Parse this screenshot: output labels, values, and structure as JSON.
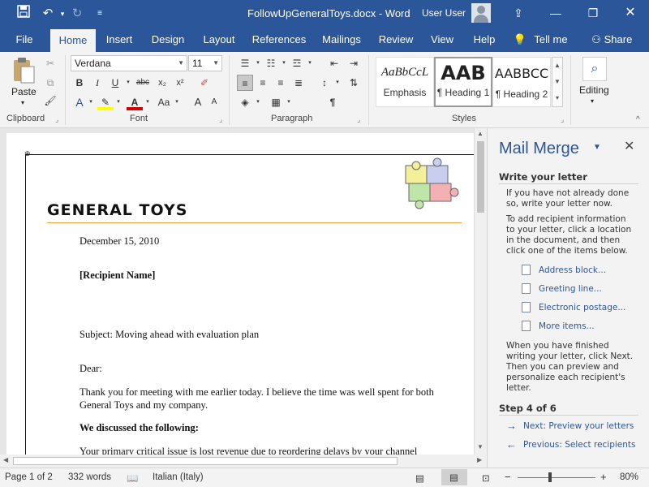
{
  "window": {
    "title": "FollowUpGeneralToys.docx  -  Word",
    "user": "User User"
  },
  "tabs": [
    "File",
    "Home",
    "Insert",
    "Design",
    "Layout",
    "References",
    "Mailings",
    "Review",
    "View",
    "Help"
  ],
  "tellme": "Tell me",
  "share": "Share",
  "ribbon": {
    "paste_label": "Paste",
    "font_name": "Verdana",
    "font_size": "11",
    "styles": [
      {
        "sample": "AaBbCcL",
        "name": "Emphasis"
      },
      {
        "sample": "AAB",
        "name": "¶ Heading 1"
      },
      {
        "sample": "AABBCC",
        "name": "¶ Heading 2"
      }
    ],
    "editing_label": "Editing",
    "group_labels": {
      "clipboard": "Clipboard",
      "font": "Font",
      "paragraph": "Paragraph",
      "styles": "Styles"
    }
  },
  "document": {
    "heading": "GENERAL TOYS",
    "date": "December 15, 2010",
    "recipient": "[Recipient Name]",
    "subject": "Subject: Moving ahead with evaluation plan",
    "salutation": "Dear:",
    "para1_line1": "Thank you for meeting with me earlier today. I believe the time was well spent for both",
    "para1_line2": "General Toys and my company.",
    "discussed": "We discussed the following:",
    "para2": "Your primary critical issue is lost revenue due to reordering delays by your channel"
  },
  "pane": {
    "title": "Mail Merge",
    "section": "Write your letter",
    "p1_line1": "If you have not already done",
    "p1_line2": "so, write your letter now.",
    "p2_line1": "To add recipient information",
    "p2_line2": "to your letter, click a location",
    "p2_line3": "in the document, and then",
    "p2_line4": "click one of the items below.",
    "links": [
      "Address block...",
      "Greeting line...",
      "Electronic postage...",
      "More items..."
    ],
    "p3_line1": "When you have finished",
    "p3_line2": "writing your letter, click Next.",
    "p3_line3": "Then you can preview and",
    "p3_line4": "personalize each recipient's",
    "p3_line5": "letter.",
    "step": "Step 4 of 6",
    "next": "Next: Preview your letters",
    "prev": "Previous: Select recipients"
  },
  "status": {
    "page": "Page 1 of 2",
    "words": "332 words",
    "language": "Italian (Italy)",
    "zoom": "80%"
  },
  "colors": {
    "accent": "#2b579a",
    "rule": "#e8a33b"
  }
}
